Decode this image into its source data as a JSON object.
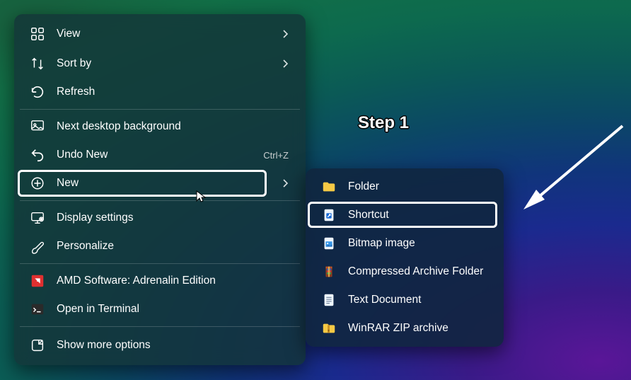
{
  "annotation": "Step 1",
  "primary_menu": {
    "highlighted_index": 5,
    "items": [
      {
        "icon": "grid-icon",
        "label": "View",
        "hasSubmenu": true,
        "shortcut": ""
      },
      {
        "icon": "sort-icon",
        "label": "Sort by",
        "hasSubmenu": true,
        "shortcut": ""
      },
      {
        "icon": "refresh-icon",
        "label": "Refresh",
        "hasSubmenu": false,
        "shortcut": ""
      },
      {
        "sep": true
      },
      {
        "icon": "desktop-bg-icon",
        "label": "Next desktop background",
        "hasSubmenu": false,
        "shortcut": ""
      },
      {
        "icon": "undo-icon",
        "label": "Undo New",
        "hasSubmenu": false,
        "shortcut": "Ctrl+Z"
      },
      {
        "icon": "add-icon",
        "label": "New",
        "hasSubmenu": true,
        "shortcut": ""
      },
      {
        "sep": true
      },
      {
        "icon": "display-icon",
        "label": "Display settings",
        "hasSubmenu": false,
        "shortcut": ""
      },
      {
        "icon": "personalize-icon",
        "label": "Personalize",
        "hasSubmenu": false,
        "shortcut": ""
      },
      {
        "sep": true
      },
      {
        "icon": "amd-icon",
        "label": "AMD Software: Adrenalin Edition",
        "hasSubmenu": false,
        "shortcut": ""
      },
      {
        "icon": "terminal-icon",
        "label": "Open in Terminal",
        "hasSubmenu": false,
        "shortcut": ""
      },
      {
        "sep": true
      },
      {
        "icon": "more-icon",
        "label": "Show more options",
        "hasSubmenu": false,
        "shortcut": ""
      }
    ]
  },
  "secondary_menu": {
    "highlighted_index": 1,
    "items": [
      {
        "icon": "folder-icon",
        "label": "Folder"
      },
      {
        "icon": "shortcut-file-icon",
        "label": "Shortcut"
      },
      {
        "icon": "bitmap-icon",
        "label": "Bitmap image"
      },
      {
        "icon": "archive-folder-icon",
        "label": "Compressed Archive Folder"
      },
      {
        "icon": "text-doc-icon",
        "label": "Text Document"
      },
      {
        "icon": "zip-icon",
        "label": "WinRAR ZIP archive"
      }
    ]
  }
}
